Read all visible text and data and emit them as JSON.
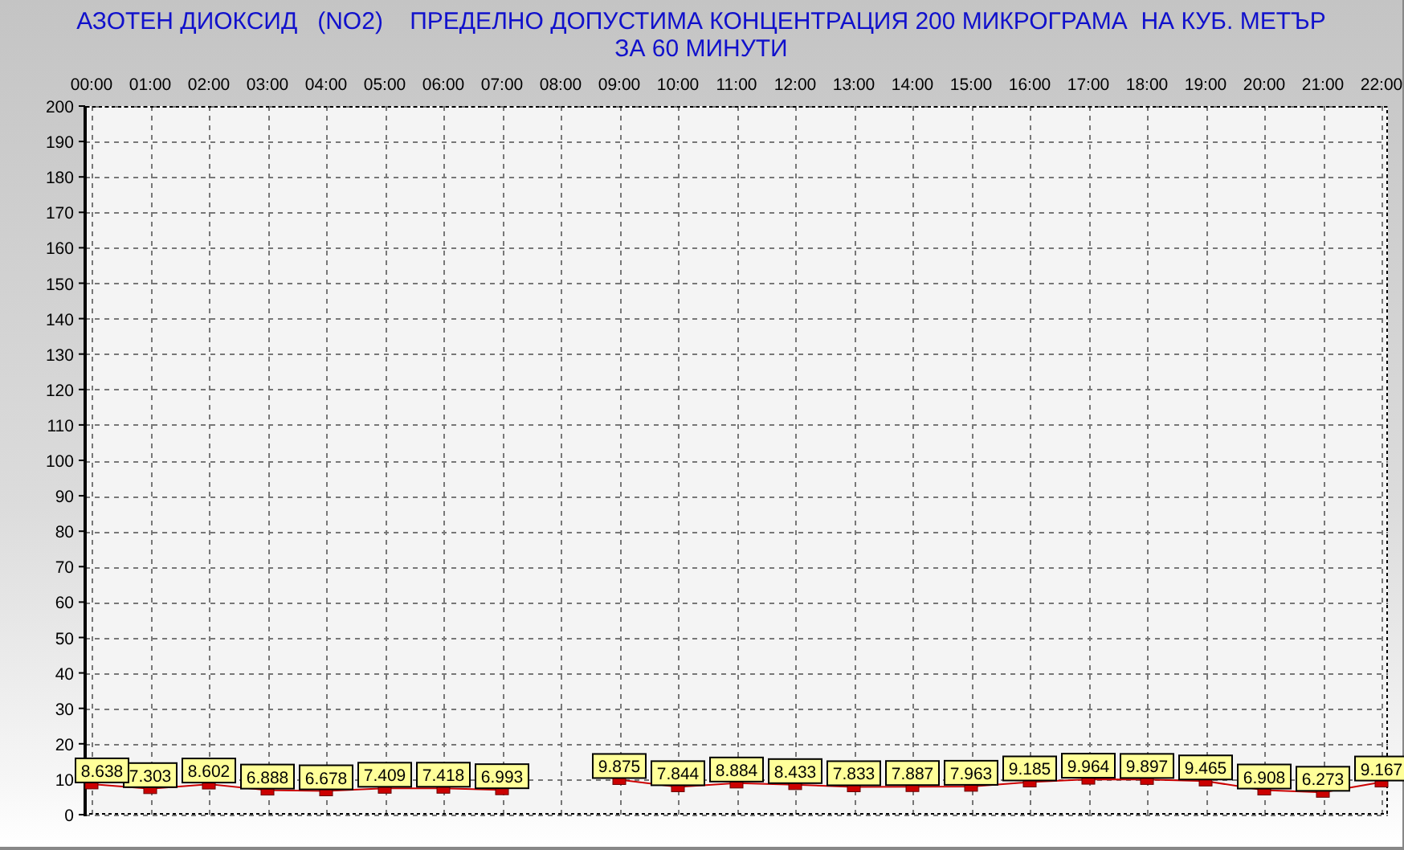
{
  "header": {
    "lines": [
      "АЗОТЕН ДИОКСИД   (NO2)    ПРЕДЕЛНО ДОПУСТИМА КОНЦЕНТРАЦИЯ 200 МИКРОГРАМА  НА КУБ. МЕТЪР",
      "ЗА 60 МИНУТИ"
    ]
  },
  "chart_data": {
    "type": "line",
    "categories": [
      "00:00",
      "01:00",
      "02:00",
      "03:00",
      "04:00",
      "05:00",
      "06:00",
      "07:00",
      "08:00",
      "09:00",
      "10:00",
      "11:00",
      "12:00",
      "13:00",
      "14:00",
      "15:00",
      "16:00",
      "17:00",
      "18:00",
      "19:00",
      "20:00",
      "21:00",
      "22:00"
    ],
    "series": [
      {
        "color": "#cc0000",
        "marker": "square",
        "values": [
          8.638,
          7.303,
          8.602,
          6.888,
          6.678,
          7.409,
          7.418,
          6.993,
          null,
          9.875,
          7.844,
          8.884,
          8.433,
          7.833,
          7.887,
          7.963,
          9.185,
          9.964,
          9.897,
          9.465,
          6.908,
          6.273,
          9.167
        ]
      }
    ],
    "ylim": [
      0,
      200
    ],
    "grid": true,
    "yticks": [
      0,
      10,
      20,
      30,
      40,
      50,
      60,
      70,
      80,
      90,
      100,
      110,
      120,
      130,
      140,
      150,
      160,
      170,
      180,
      190,
      200
    ],
    "data_labels": true
  }
}
